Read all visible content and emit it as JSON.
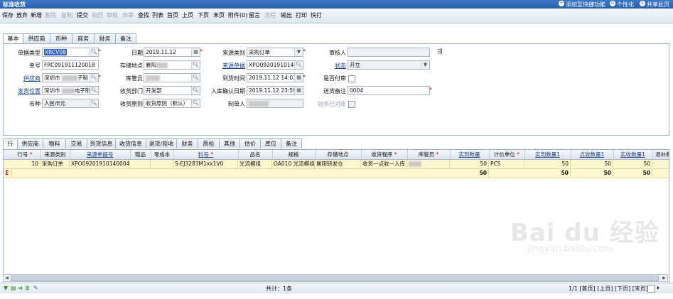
{
  "titlebar": {
    "title": "标准收货",
    "links": [
      "添加至快捷功能",
      "个性化",
      "共享此页"
    ]
  },
  "toolbar": {
    "buttons": [
      {
        "label": "保存",
        "enabled": true
      },
      {
        "label": "放弃",
        "enabled": true
      },
      {
        "label": "新增",
        "enabled": true
      },
      {
        "label": "删除",
        "enabled": false
      },
      {
        "label": "复制",
        "enabled": false
      },
      {
        "label": "提交",
        "enabled": true
      },
      {
        "label": "收回",
        "enabled": false
      },
      {
        "label": "审核",
        "enabled": false
      },
      {
        "label": "弃审",
        "enabled": false
      },
      {
        "label": "查找",
        "enabled": true
      },
      {
        "label": "列表",
        "enabled": true
      },
      {
        "label": "首页",
        "enabled": true
      },
      {
        "label": "上页",
        "enabled": true
      },
      {
        "label": "下页",
        "enabled": true
      },
      {
        "label": "末页",
        "enabled": true
      },
      {
        "label": "附件(0)",
        "enabled": true
      },
      {
        "label": "留言",
        "enabled": true
      },
      {
        "label": "流程",
        "enabled": false
      },
      {
        "label": "输出",
        "enabled": true
      },
      {
        "label": "打印",
        "enabled": true
      },
      {
        "label": "快打",
        "enabled": true
      }
    ]
  },
  "header_tabs": [
    "基本",
    "供应商",
    "币种",
    "商务",
    "财务",
    "备注"
  ],
  "form": {
    "doc_type": {
      "label": "单据类型",
      "value": "XRCV08"
    },
    "doc_no": {
      "label": "单号",
      "value": "FRC091911120018"
    },
    "supplier": {
      "label": "供应商",
      "value": "深圳市"
    },
    "ship_from": {
      "label": "发货位置",
      "value": "深圳市"
    },
    "currency": {
      "label": "币种",
      "value": "人民币元"
    },
    "date": {
      "label": "日期",
      "value": "2019.11.12"
    },
    "storage": {
      "label": "存储地点",
      "value": "襄阳"
    },
    "keeper": {
      "label": "库管员",
      "value": ""
    },
    "recv_dept": {
      "label": "收货部门",
      "value": "开发部"
    },
    "recv_rule": {
      "label": "收货原则",
      "value": "收货原则（默认）"
    },
    "src_type": {
      "label": "来源类别",
      "value": "采购订单"
    },
    "src_doc": {
      "label": "来源单据",
      "value": "XPO09201910140004"
    },
    "arrive_time": {
      "label": "到货时间",
      "value": "2019.11.12 14:01:35"
    },
    "in_confirm": {
      "label": "入库确认日期",
      "value": "2019.11.12 23:59:00"
    },
    "maker": {
      "label": "制单人",
      "value": ""
    },
    "auditor": {
      "label": "审核人",
      "value": ""
    },
    "status": {
      "label": "状态",
      "value": "开立"
    },
    "is_audit": {
      "label": "是否付审"
    },
    "ship_note": {
      "label": "送货备注",
      "value": "0004"
    },
    "finance_match": {
      "label": "财务已对账"
    },
    "side_icon": "tree-expand-icon"
  },
  "line_tabs": [
    "行",
    "供应商",
    "物料",
    "交易",
    "到货信息",
    "收货信息",
    "退货/拒收",
    "财务",
    "质检",
    "其他",
    "估价",
    "库位",
    "备注"
  ],
  "grid": {
    "columns": [
      {
        "label": "行号",
        "req": true,
        "u": false
      },
      {
        "label": "来源类别",
        "req": false,
        "u": false
      },
      {
        "label": "来源单据号",
        "req": false,
        "u": true
      },
      {
        "label": "赠品",
        "req": false,
        "u": false
      },
      {
        "label": "零成本",
        "req": false,
        "u": false
      },
      {
        "label": "料号",
        "req": true,
        "u": true
      },
      {
        "label": "品名",
        "req": false,
        "u": false
      },
      {
        "label": "规格",
        "req": false,
        "u": false
      },
      {
        "label": "存储地点",
        "req": false,
        "u": false
      },
      {
        "label": "收货程序",
        "req": true,
        "u": false
      },
      {
        "label": "库管员",
        "req": true,
        "u": false
      },
      {
        "label": "实到数量",
        "req": false,
        "u": true
      },
      {
        "label": "计价单位",
        "req": true,
        "u": false
      },
      {
        "label": "实到数量1",
        "req": false,
        "u": true
      },
      {
        "label": "点收数量1",
        "req": false,
        "u": true
      },
      {
        "label": "实收数量1",
        "req": false,
        "u": true
      },
      {
        "label": "退补数",
        "req": false,
        "u": false
      }
    ],
    "rows": [
      [
        "10",
        "采购订单",
        "XPO09201910140004...",
        "",
        "",
        "S-EJ3283M1xx1V0",
        "光流模组",
        "OA010 光流模组...",
        "襄阳研发仓",
        "收货—点收—入库",
        "",
        "50",
        "PCS",
        "50",
        "50",
        "50",
        ""
      ]
    ],
    "total_row": {
      "marker": "Σ",
      "values": [
        "50",
        "50",
        "50",
        "50"
      ]
    }
  },
  "statusbar": {
    "count_label": "共计：1条",
    "pager": "1/1 [首页] [上页] [下页] [末页]"
  },
  "watermark": {
    "main": "Bai du 经验",
    "sub": "jingyan.baidu.com"
  }
}
